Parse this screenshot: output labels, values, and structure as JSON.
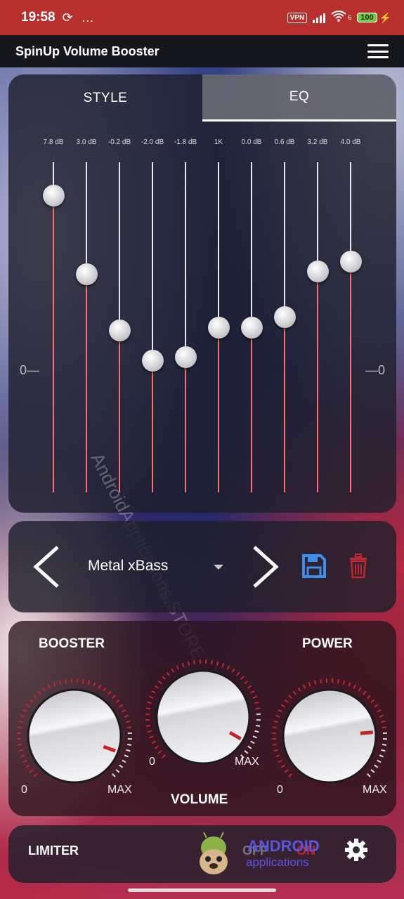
{
  "status_bar": {
    "time": "19:58",
    "extra": "…",
    "vpn_label": "VPN",
    "network": "6",
    "battery": "100"
  },
  "app_bar": {
    "title": "SpinUp Volume Booster"
  },
  "eq_panel": {
    "tabs": [
      {
        "label": "STYLE",
        "active": false
      },
      {
        "label": "EQ",
        "active": true
      }
    ],
    "bands": [
      {
        "label": "7.8 dB",
        "level": 0.9
      },
      {
        "label": "3.0 dB",
        "level": 0.66
      },
      {
        "label": "-0.2 dB",
        "level": 0.49
      },
      {
        "label": "-2.0 dB",
        "level": 0.4
      },
      {
        "label": "-1.8 dB",
        "level": 0.41
      },
      {
        "label": "1K",
        "level": 0.5
      },
      {
        "label": "0.0 dB",
        "level": 0.5
      },
      {
        "label": "0.6 dB",
        "level": 0.53
      },
      {
        "label": "3.2 dB",
        "level": 0.67
      },
      {
        "label": "4.0 dB",
        "level": 0.7
      }
    ],
    "zero_left": "0—",
    "zero_right": "—0"
  },
  "preset": {
    "name": "Metal xBass",
    "save_icon": "save-icon",
    "delete_icon": "trash-icon"
  },
  "knobs": {
    "booster_title": "BOOSTER",
    "power_title": "POWER",
    "volume_title": "VOLUME",
    "min_label": "0",
    "max_label": "MAX"
  },
  "limiter": {
    "label": "LIMITER",
    "off_label": "OFF",
    "on_label": "ON"
  },
  "watermark": "AndroidApplications.STORE",
  "brand": {
    "line1": "ANDROID",
    "line2": "applications"
  },
  "colors": {
    "accent_red": "#c0282e",
    "save_blue": "#3d8ee8",
    "eq_fill": "#ff6e6e",
    "status_bar": "#b8302e"
  }
}
